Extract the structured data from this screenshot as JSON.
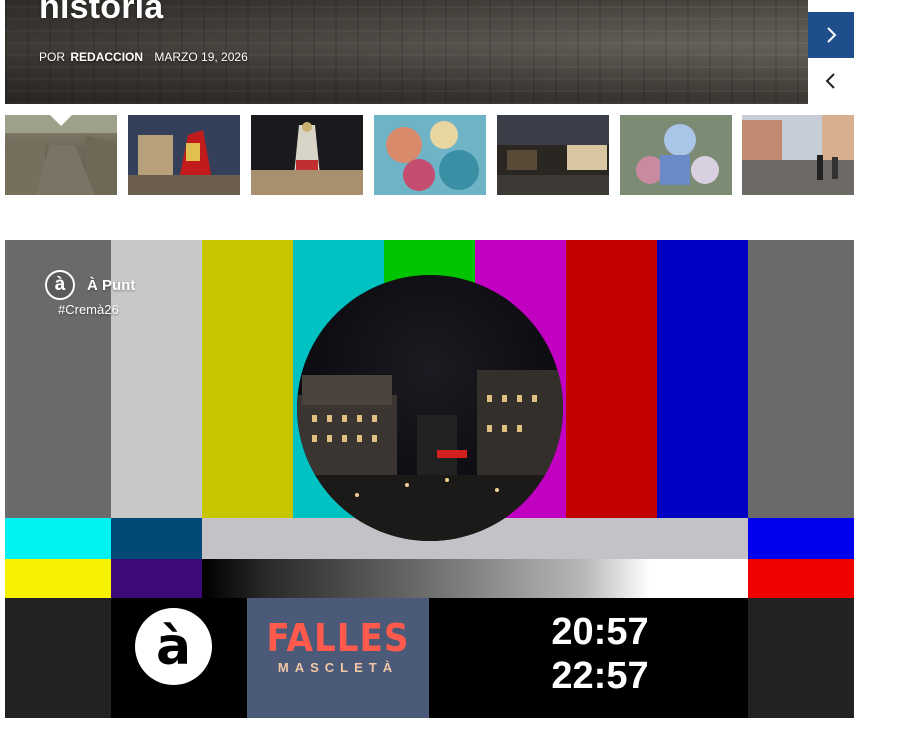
{
  "hero": {
    "title": "historia",
    "meta_by": "POR",
    "meta_author": "REDACCION",
    "meta_date": "MARZO 19, 2026"
  },
  "thumbnails": [
    {
      "name": "thumb-old-street",
      "active": true
    },
    {
      "name": "thumb-church-falla"
    },
    {
      "name": "thumb-virgin-offering"
    },
    {
      "name": "thumb-colorful-falla"
    },
    {
      "name": "thumb-night-stalls"
    },
    {
      "name": "thumb-ninot-figures"
    },
    {
      "name": "thumb-city-crowd"
    }
  ],
  "tv": {
    "brand_logo": "à",
    "brand_name": "À Punt",
    "hashtag": "#Cremà26",
    "ap_logo": "à",
    "falles_word": "FALLES",
    "falles_sub": "MASCLETÀ",
    "time_1": "20:57",
    "time_2": "22:57"
  },
  "colors": {
    "nav_blue": "#1e4f8c",
    "bar_gray": "#6a6a6a",
    "bar_white": "#c8c8c8",
    "bar_yellow": "#c8c400",
    "bar_cyan": "#00c2c2",
    "bar_green": "#00c400",
    "bar_magenta": "#c200c2",
    "bar_red": "#c20000",
    "bar_blue": "#0000c2",
    "falles_red": "#ff5a4c"
  }
}
